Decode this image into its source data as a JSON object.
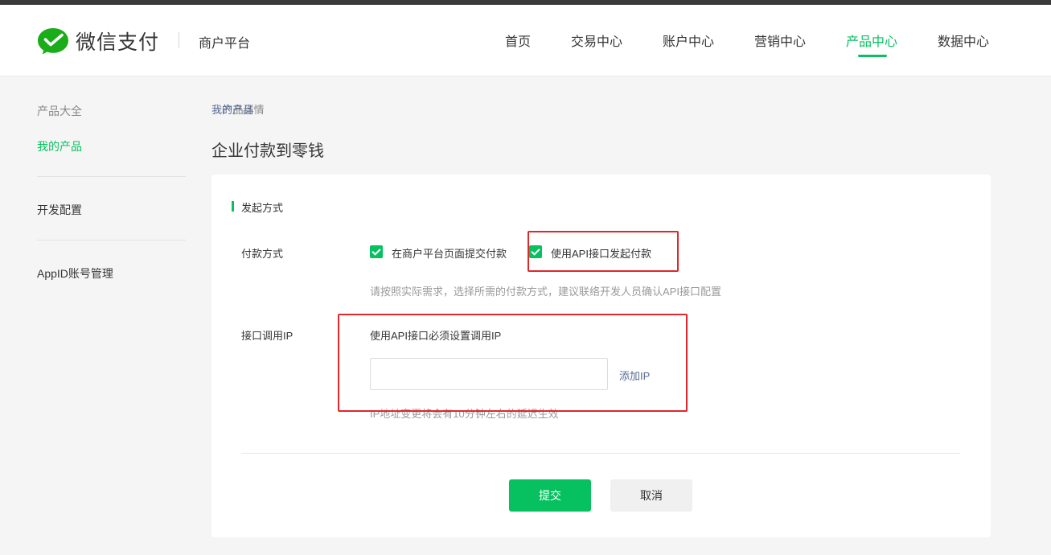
{
  "header": {
    "brand": "微信支付",
    "platform": "商户平台",
    "nav": [
      {
        "label": "首页"
      },
      {
        "label": "交易中心"
      },
      {
        "label": "账户中心"
      },
      {
        "label": "营销中心"
      },
      {
        "label": "产品中心",
        "active": true
      },
      {
        "label": "数据中心"
      }
    ]
  },
  "sidebar": {
    "items": [
      {
        "label": "产品大全"
      },
      {
        "label": "我的产品"
      },
      {
        "label": "开发配置"
      },
      {
        "label": "AppID账号管理"
      }
    ]
  },
  "breadcrumb": {
    "items": [
      "我的产品",
      "产品详情"
    ],
    "separator": "/"
  },
  "page": {
    "title": "企业付款到零钱"
  },
  "form": {
    "section_title": "发起方式",
    "payment_method": {
      "label": "付款方式",
      "options": [
        {
          "label": "在商户平台页面提交付款",
          "checked": true
        },
        {
          "label": "使用API接口发起付款",
          "checked": true
        }
      ],
      "hint": "请按照实际需求，选择所需的付款方式，建议联络开发人员确认API接口配置"
    },
    "ip": {
      "label": "接口调用IP",
      "desc": "使用API接口必须设置调用IP",
      "value": "",
      "placeholder": "",
      "add_link": "添加IP",
      "hint": "IP地址变更将会有10分钟左右的延迟生效"
    },
    "submit_label": "提交",
    "cancel_label": "取消"
  },
  "colors": {
    "accent": "#07c160",
    "highlight": "#e0272b",
    "link": "#576b95"
  },
  "icons": {
    "logo": "wechat-pay-logo-icon",
    "checkbox": "check-icon"
  }
}
